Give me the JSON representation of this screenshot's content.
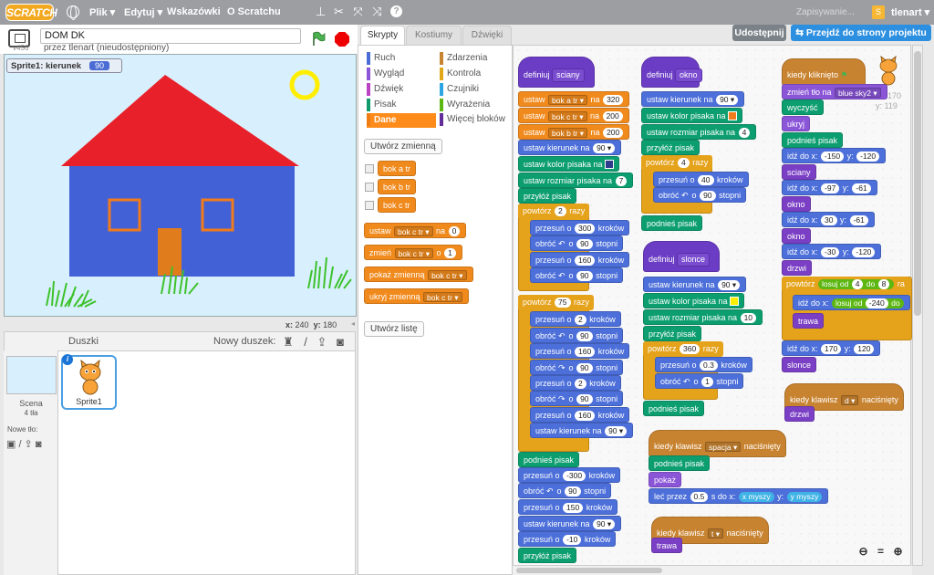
{
  "topbar": {
    "logo": "SCRATCH",
    "menu": [
      "Plik ▾",
      "Edytuj ▾",
      "Wskazówki",
      "O Scratchu"
    ],
    "saving": "Zapisywanie...",
    "username": "tlenart ▾",
    "bg_color": "#9c9ea2"
  },
  "stage": {
    "version": "v456",
    "project_title": "DOM DK",
    "author": "przez tlenart (nieudostępniony)",
    "monitor_label": "Sprite1: kierunek",
    "monitor_value": "90",
    "coords_x_label": "x:",
    "coords_x": "240",
    "coords_y_label": "y:",
    "coords_y": "180"
  },
  "sprites": {
    "header": "Duszki",
    "new_sprite": "Nowy duszek:",
    "scene_label": "Scena",
    "scene_count": "4 tła",
    "new_bg": "Nowe tło:",
    "sprite_name": "Sprite1"
  },
  "palette": {
    "tabs": [
      "Skrypty",
      "Kostiumy",
      "Dźwięki"
    ],
    "categories_left": [
      {
        "label": "Ruch",
        "color": "#4a6cd4"
      },
      {
        "label": "Wygląd",
        "color": "#8a55d7"
      },
      {
        "label": "Dźwięk",
        "color": "#bb42c3"
      },
      {
        "label": "Pisak",
        "color": "#0e9a6c"
      },
      {
        "label": "Dane",
        "color": "#ee7d16"
      }
    ],
    "categories_right": [
      {
        "label": "Zdarzenia",
        "color": "#c88330"
      },
      {
        "label": "Kontrola",
        "color": "#e1a91a"
      },
      {
        "label": "Czujniki",
        "color": "#2ca5e2"
      },
      {
        "label": "Wyrażenia",
        "color": "#5cb712"
      },
      {
        "label": "Więcej bloków",
        "color": "#632d99"
      }
    ],
    "make_variable": "Utwórz zmienną",
    "variables": [
      "bok a tr",
      "bok b tr",
      "bok c tr"
    ],
    "make_list": "Utwórz listę",
    "blk_set": "ustaw",
    "blk_set_var": "bok c tr ▾",
    "blk_set_to": "na",
    "blk_set_val": "0",
    "blk_change": "zmień",
    "blk_change_var": "bok c tr ▾",
    "blk_change_o": "o",
    "blk_change_val": "1",
    "blk_show": "pokaż zmienną",
    "blk_show_var": "bok c tr ▾",
    "blk_hide": "ukryj zmienną",
    "blk_hide_var": "bok c tr ▾"
  },
  "header_buttons": {
    "share": "Udostępnij",
    "goto": "Przejdź do strony projektu"
  },
  "sprite_info": {
    "x": "170",
    "y_label": "y:",
    "y": "119"
  },
  "scripts": {
    "define": "definiuj",
    "define_sciany": "sciany",
    "define_okno": "okno",
    "define_slonce": "slonce",
    "set_var": "ustaw",
    "to": "na",
    "bok_a": "bok a tr ▾",
    "bok_c": "bok c tr ▾",
    "bok_b": "bok b tr ▾",
    "v320": "320",
    "v200": "200",
    "v200b": "200",
    "point_dir": "ustaw kierunek na",
    "v90": "90 ▾",
    "set_pen_color": "ustaw kolor pisaka na",
    "set_pen_size": "ustaw rozmiar pisaka na",
    "v7": "7",
    "v4": "4",
    "v10": "10",
    "pen_down": "przyłóż pisak",
    "pen_up": "podnieś pisak",
    "repeat": "powtórz",
    "times": "razy",
    "r2": "2",
    "r4": "4",
    "r75": "75",
    "r360": "360",
    "move": "przesuń o",
    "steps": "kroków",
    "turn": "obróć",
    "o": "o",
    "degrees": "stopni",
    "m300": "300",
    "m160": "160",
    "d90": "90",
    "m2": "2",
    "m40": "40",
    "m03": "0.3",
    "d1": "1",
    "m_300": "-300",
    "m150": "150",
    "m_10": "-10",
    "when_flag": "kiedy kliknięto",
    "change_effect": "zmień tło na",
    "bg_value": "blue sky2 ▾",
    "clear": "wyczyść",
    "hide": "ukryj",
    "goto_xy": "idź do x:",
    "y": "y:",
    "gx1": "-150",
    "gy1": "-120",
    "gx2": "-97",
    "gy2": "-61",
    "gx3": "30",
    "gy3": "-61",
    "gx4": "-30",
    "gy4": "-120",
    "gx5": "170",
    "gy5": "120",
    "call_sciany": "sciany",
    "call_okno": "okno",
    "call_drzwi": "drzwi",
    "call_slonce": "slonce",
    "call_trawa": "trawa",
    "random": "losuj od",
    "to_word": "do",
    "rnd_a": "4",
    "rnd_b": "8",
    "rnd_c": "ra",
    "rnd_x_a": "-240",
    "when_key": "kiedy klawisz",
    "pressed": "naciśnięty",
    "key_space": "spacja ▾",
    "key_d": "d ▾",
    "key_t": "t ▾",
    "show": "pokaż",
    "glide": "leć przez",
    "glide_sec": "0.5",
    "glide_s": "s do x:",
    "mouse_x": "x myszy",
    "mouse_y": "y myszy",
    "pen_color_blue": "#2f3c8c",
    "pen_color_orange": "#f07c1c",
    "pen_color_yellow": "#ffee00"
  }
}
